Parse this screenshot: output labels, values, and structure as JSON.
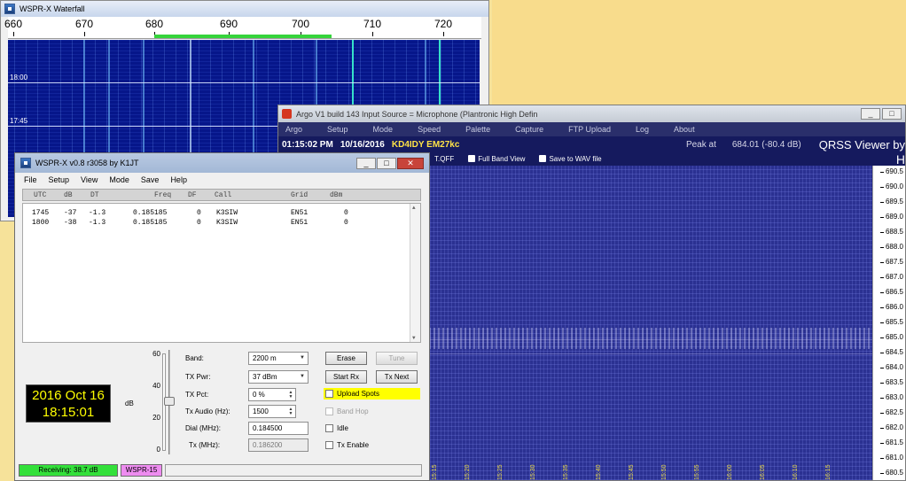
{
  "waterfall": {
    "title": "WSPR-X Waterfall",
    "freq_ticks": [
      "660",
      "670",
      "680",
      "690",
      "700",
      "710",
      "720"
    ],
    "time_labels": [
      "18:00",
      "17:45"
    ]
  },
  "argo": {
    "title": "Argo V1 build 143 Input Source = Microphone (Plantronic High Defin",
    "menu": [
      "Argo",
      "Setup",
      "Mode",
      "Speed",
      "Palette",
      "Capture",
      "FTP Upload",
      "Log",
      "About"
    ],
    "time": "01:15:02 PM",
    "date": "10/16/2016",
    "callsign": "KD4IDY EM27kc",
    "peak_label": "Peak at",
    "peak_value": "684.01 (-80.4 dB)",
    "brand": "QRSS Viewer by",
    "brand2": "H",
    "options": {
      "tqff": "T.QFF",
      "full_band": "Full Band View",
      "save_wav": "Save to WAV file"
    },
    "scale": [
      "690.5",
      "690.0",
      "689.5",
      "689.0",
      "688.5",
      "688.0",
      "687.5",
      "687.0",
      "686.5",
      "686.0",
      "685.5",
      "685.0",
      "684.5",
      "684.0",
      "683.5",
      "683.0",
      "682.5",
      "682.0",
      "681.5",
      "681.0",
      "680.5"
    ],
    "time_ticks": [
      "15:15",
      "15:20",
      "15:25",
      "15:30",
      "15:35",
      "15:40",
      "15:45",
      "15:50",
      "15:55",
      "16:00",
      "16:05",
      "16:10",
      "16:15"
    ],
    "ctrls": {
      "min": "_",
      "max": "□"
    }
  },
  "wspr": {
    "title": "WSPR-X   v0.8 r3058    by K1JT",
    "ctrls": {
      "min": "_",
      "max": "□",
      "close": "✕"
    },
    "menu": [
      "File",
      "Setup",
      "View",
      "Mode",
      "Save",
      "Help"
    ],
    "headers": [
      "UTC",
      "dB",
      "DT",
      "Freq",
      "DF",
      "Call",
      "Grid",
      "dBm"
    ],
    "rows": [
      [
        "1745",
        "-37",
        "-1.3",
        "0.185185",
        "0",
        "K3SIW",
        "EN51",
        "0"
      ],
      [
        "1800",
        "-38",
        "-1.3",
        "0.185185",
        "0",
        "K3SIW",
        "EN51",
        "0"
      ]
    ],
    "clock_date": "2016 Oct 16",
    "clock_time": "18:15:01",
    "db_scale": [
      "60",
      "40",
      "20",
      "0"
    ],
    "db_unit": "dB",
    "form": {
      "band_label": "Band:",
      "band_value": "2200 m",
      "txpwr_label": "TX Pwr:",
      "txpwr_value": "37 dBm",
      "txpct_label": "TX Pct:",
      "txpct_value": "0  %",
      "txaudio_label": "Tx Audio (Hz):",
      "txaudio_value": "1500",
      "dial_label": "Dial (MHz):",
      "dial_value": "0.184500",
      "tx_label": "Tx (MHz):",
      "tx_value": "0.186200"
    },
    "buttons": {
      "erase": "Erase",
      "tune": "Tune",
      "start_rx": "Start Rx",
      "tx_next": "Tx Next"
    },
    "checks": {
      "upload": "Upload Spots",
      "band_hop": "Band Hop",
      "idle": "Idle",
      "tx_enable": "Tx Enable"
    },
    "status": {
      "receiving": "Receiving:  38.7 dB",
      "mode": "WSPR-15"
    }
  }
}
